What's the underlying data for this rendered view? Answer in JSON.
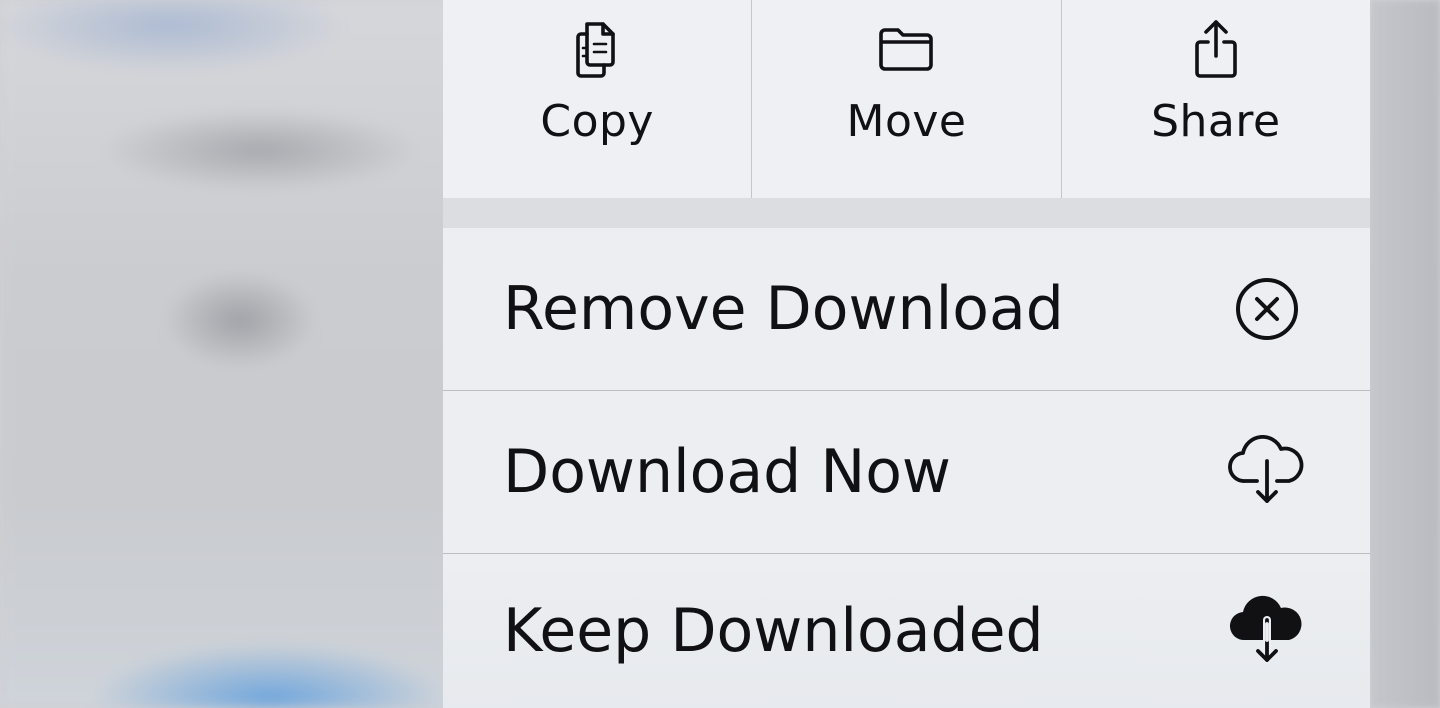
{
  "actions": [
    {
      "label": "Copy",
      "icon": "copy-icon"
    },
    {
      "label": "Move",
      "icon": "folder-icon"
    },
    {
      "label": "Share",
      "icon": "share-icon"
    }
  ],
  "menu_items": [
    {
      "label": "Remove Download",
      "icon": "remove-circle-icon"
    },
    {
      "label": "Download Now",
      "icon": "cloud-download-outline-icon"
    },
    {
      "label": "Keep Downloaded",
      "icon": "cloud-download-filled-icon"
    }
  ],
  "colors": {
    "menu_background": "#eceef1",
    "separator": "#dcdde0",
    "text": "#111114"
  }
}
